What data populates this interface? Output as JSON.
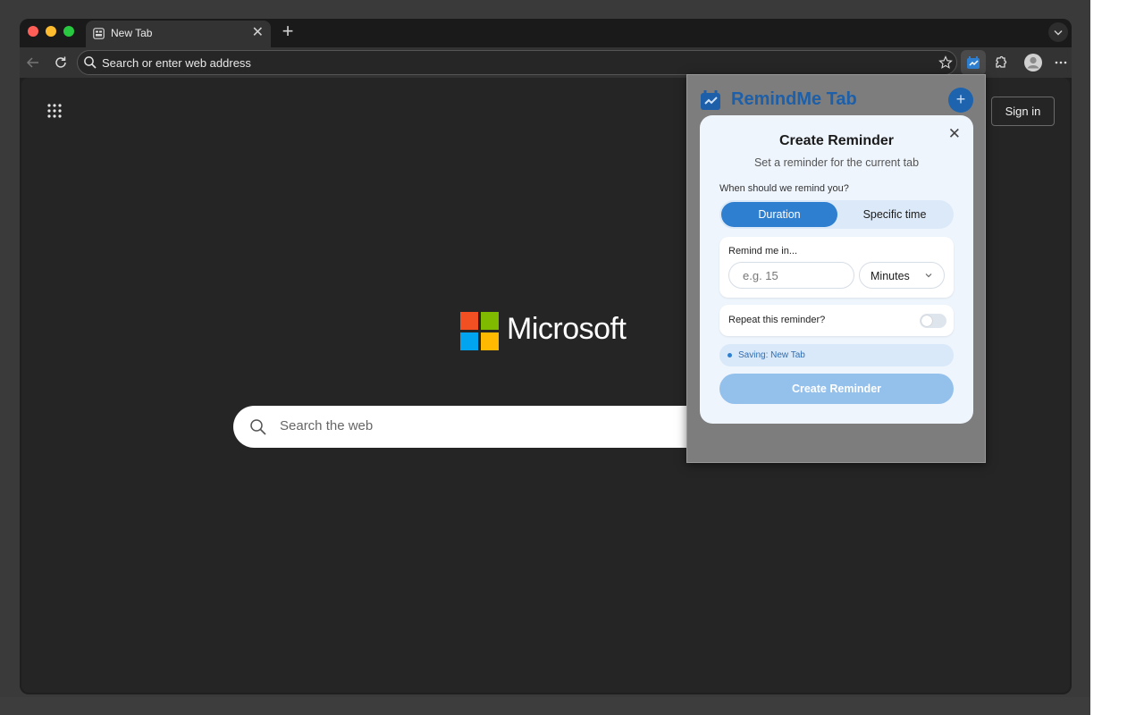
{
  "browser": {
    "tab": {
      "title": "New Tab",
      "close_glyph": "✕"
    },
    "new_tab_glyph": "+",
    "address_bar": {
      "placeholder": "Search or enter web address"
    }
  },
  "page": {
    "sign_in_label": "Sign in",
    "brand_name": "Microsoft",
    "brand_colors": [
      "#f25022",
      "#7fba00",
      "#00a4ef",
      "#ffb900"
    ],
    "search_placeholder": "Search the web"
  },
  "extension": {
    "name": "RemindMe Tab",
    "add_glyph": "+",
    "accent_color": "#2f7fd1",
    "modal": {
      "close_glyph": "✕",
      "title": "Create Reminder",
      "subtitle": "Set a reminder for the current tab",
      "when_label": "When should we remind you?",
      "modes": [
        {
          "label": "Duration",
          "selected": true
        },
        {
          "label": "Specific time",
          "selected": false
        }
      ],
      "remind_label": "Remind me in...",
      "amount_placeholder": "e.g. 15",
      "unit_selected": "Minutes",
      "repeat_label": "Repeat this reminder?",
      "repeat_enabled": false,
      "saving_text": "Saving: New Tab",
      "submit_label": "Create Reminder"
    }
  }
}
